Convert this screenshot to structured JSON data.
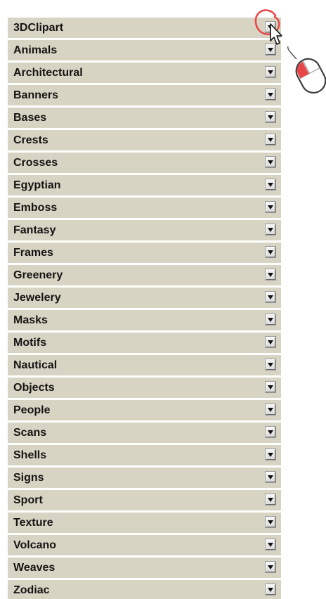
{
  "categories": [
    {
      "label": "3DClipart"
    },
    {
      "label": "Animals"
    },
    {
      "label": "Architectural"
    },
    {
      "label": "Banners"
    },
    {
      "label": "Bases"
    },
    {
      "label": "Crests"
    },
    {
      "label": "Crosses"
    },
    {
      "label": "Egyptian"
    },
    {
      "label": "Emboss"
    },
    {
      "label": "Fantasy"
    },
    {
      "label": "Frames"
    },
    {
      "label": "Greenery"
    },
    {
      "label": "Jewelery"
    },
    {
      "label": "Masks"
    },
    {
      "label": "Motifs"
    },
    {
      "label": "Nautical"
    },
    {
      "label": "Objects"
    },
    {
      "label": "People"
    },
    {
      "label": "Scans"
    },
    {
      "label": "Shells"
    },
    {
      "label": "Signs"
    },
    {
      "label": "Sport"
    },
    {
      "label": "Texture"
    },
    {
      "label": "Volcano"
    },
    {
      "label": "Weaves"
    },
    {
      "label": "Zodiac"
    }
  ],
  "icons": {
    "expand": "chevron-down-icon",
    "click_marker": "click-highlight-icon",
    "cursor": "mouse-pointer-icon",
    "mouse": "mouse-left-click-icon"
  },
  "colors": {
    "row_background": "#d8d4c3",
    "row_text": "#141414",
    "click_highlight": "#e8474a"
  }
}
